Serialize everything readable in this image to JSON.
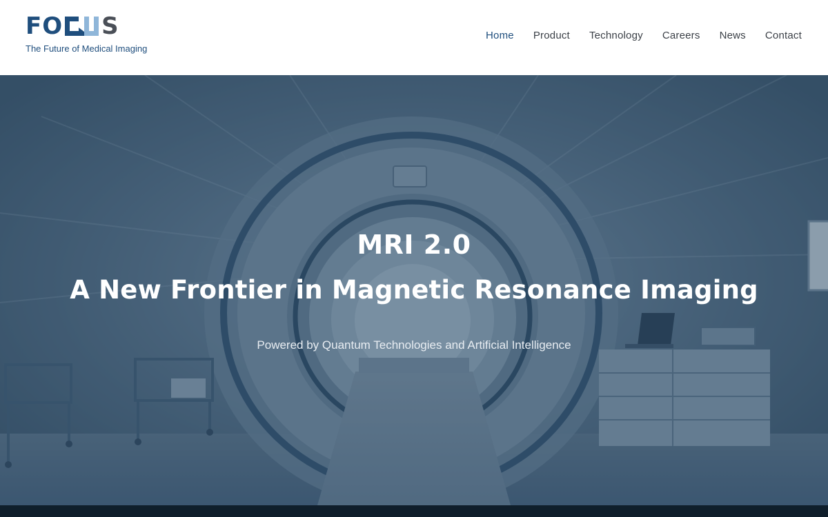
{
  "brand": {
    "logo_part1": "FO",
    "logo_part2": "S",
    "tagline": "The Future of Medical Imaging",
    "colors": {
      "primary": "#1f4e7d",
      "secondary": "#4a4f57",
      "accent": "#8fb6d9"
    }
  },
  "nav": {
    "items": [
      {
        "label": "Home",
        "active": true
      },
      {
        "label": "Product"
      },
      {
        "label": "Technology"
      },
      {
        "label": "Careers"
      },
      {
        "label": "News"
      },
      {
        "label": "Contact"
      }
    ]
  },
  "hero": {
    "title": "MRI 2.0",
    "subtitle": "A New Frontier in Magnetic Resonance Imaging",
    "tagline": "Powered by Quantum Technologies and Artificial Intelligence",
    "overlay_color": "#2e4a63"
  },
  "footer": {
    "color": "#0f1e2b"
  }
}
